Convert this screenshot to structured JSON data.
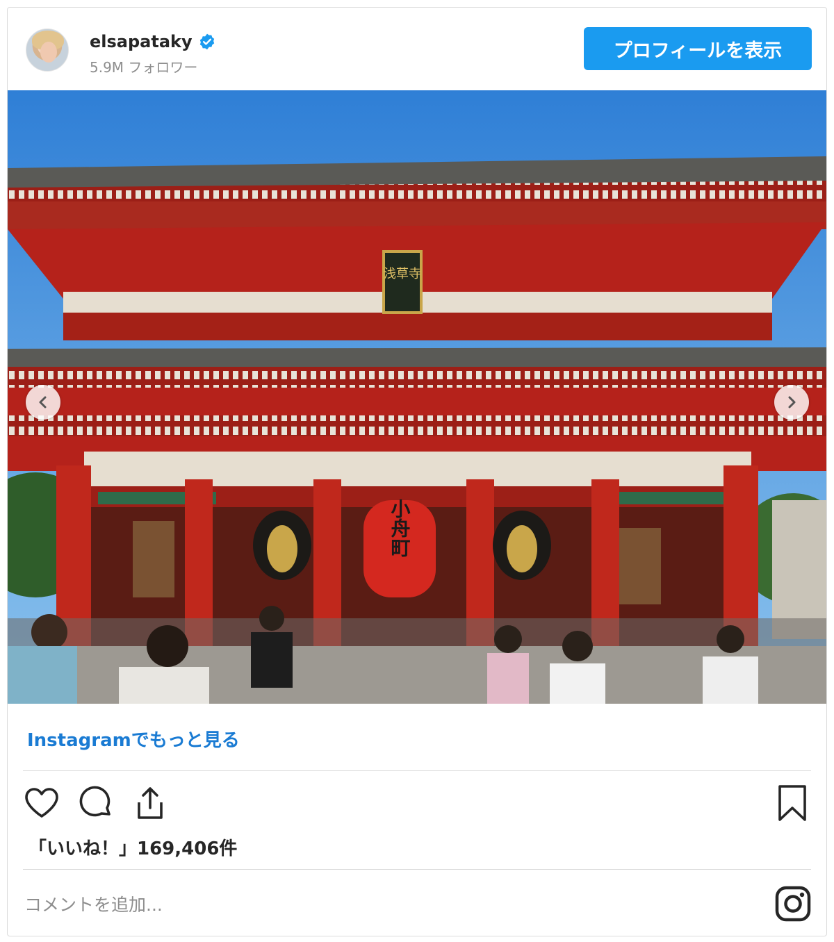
{
  "header": {
    "username": "elsapataky",
    "followers": "5.9M フォロワー",
    "profile_button": "プロフィールを表示"
  },
  "post": {
    "image_sign": "浅草寺",
    "lantern_text": "小舟町",
    "more_link": "Instagramでもっと見る",
    "likes": "「いいね！」169,406件",
    "comment_placeholder": "コメントを追加..."
  },
  "icons": {
    "verified": "verified-badge-icon",
    "like": "heart-icon",
    "comment": "comment-bubble-icon",
    "share": "share-icon",
    "save": "bookmark-icon",
    "instagram": "instagram-logo-icon",
    "prev": "chevron-left-icon",
    "next": "chevron-right-icon"
  },
  "colors": {
    "accent": "#1a9bf0",
    "link": "#1a7bd3",
    "gate_red": "#b5221b"
  }
}
